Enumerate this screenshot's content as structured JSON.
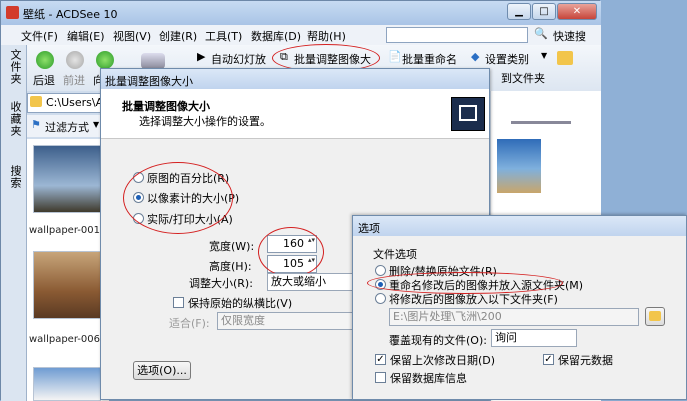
{
  "window": {
    "title": "壁纸 - ACDSee 10",
    "minimize": "▁",
    "maximize": "□",
    "close": "✕"
  },
  "menu": [
    "文件(F)",
    "编辑(E)",
    "视图(V)",
    "创建(R)",
    "工具(T)",
    "数据库(D)",
    "帮助(H)"
  ],
  "search": {
    "label": "快速搜",
    "placeholder": ""
  },
  "toolbar": {
    "back": "后退",
    "forward": "前进",
    "up": "向上",
    "slideshow": "自动幻灯放映",
    "batch_resize": "批量调整图像大小",
    "batch_rename": "批量重命名",
    "set_category": "设置类别",
    "to_folder": "到文件夹"
  },
  "side_tabs": [
    "文件夹",
    "收藏夹",
    "搜索"
  ],
  "address": "C:\\Users\\Ad",
  "filter": "过滤方式",
  "thumbnails": [
    "wallpaper-001",
    "wallpaper-006"
  ],
  "resize_dialog": {
    "title": "批量调整图像大小",
    "heading": "批量调整图像大小",
    "subheading": "选择调整大小操作的设置。",
    "opt_percent": "原图的百分比(R)",
    "opt_pixels": "以像素计的大小(P)",
    "opt_print": "实际/打印大小(A)",
    "width_label": "宽度(W):",
    "width_value": "160",
    "height_label": "高度(H):",
    "height_value": "105",
    "resize_label": "调整大小(R):",
    "resize_value": "放大或缩小",
    "keep_ratio": "保持原始的纵横比(V)",
    "fit_label": "适合(F):",
    "fit_value": "仅限宽度",
    "options_button": "选项(O)..."
  },
  "options_dialog": {
    "title": "选项",
    "group": "文件选项",
    "opt_replace": "删除/替换原始文件(R)",
    "opt_rename": "重命名修改后的图像并放入源文件夹(M)",
    "opt_folder": "将修改后的图像放入以下文件夹(F)",
    "folder_path": "E:\\图片处理\\飞洲\\200",
    "overwrite_label": "覆盖现有的文件(O):",
    "overwrite_value": "询问",
    "keep_date": "保留上次修改日期(D)",
    "keep_meta": "保留元数据",
    "keep_db": "保留数据库信息"
  }
}
